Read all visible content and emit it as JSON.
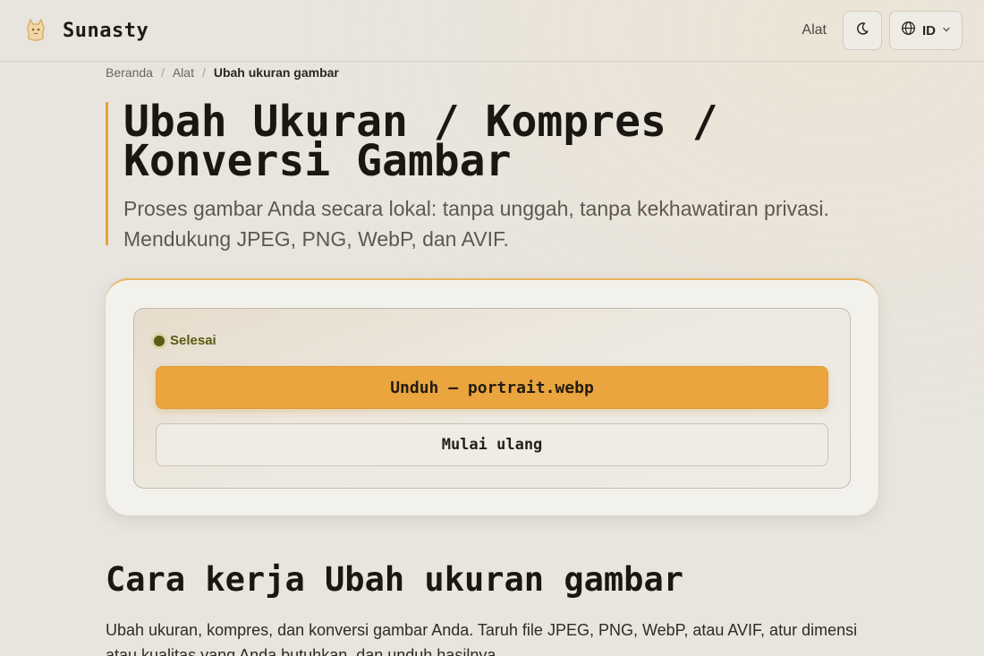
{
  "brand": {
    "name": "Sunasty"
  },
  "header": {
    "tools_label": "Alat",
    "lang_code": "ID"
  },
  "icons": [
    "logo-icon",
    "moon-icon",
    "globe-icon",
    "chevron-down-icon"
  ],
  "breadcrumb": [
    "Beranda",
    "Alat",
    "Ubah ukuran gambar"
  ],
  "breadcrumb_separator": "/",
  "hero": {
    "title": "Ubah Ukuran / Kompres / Konversi Gambar",
    "subtitle": "Proses gambar Anda secara lokal: tanpa unggah, tanpa kekhawatiran privasi. Mendukung JPEG, PNG, WebP, dan AVIF."
  },
  "result": {
    "status": "Selesai",
    "download_label": "Unduh — portrait.webp",
    "reset_label": "Mulai ulang"
  },
  "how": {
    "title": "Cara kerja Ubah ukuran gambar",
    "text": "Ubah ukuran, kompres, dan konversi gambar Anda. Taruh file JPEG, PNG, WebP, atau AVIF, atur dimensi atau kualitas yang Anda butuhkan, dan unduh hasilnya."
  },
  "colors": {
    "accent": "#eaa53e",
    "status": "#5a5a14",
    "background": "#e8e5de"
  }
}
